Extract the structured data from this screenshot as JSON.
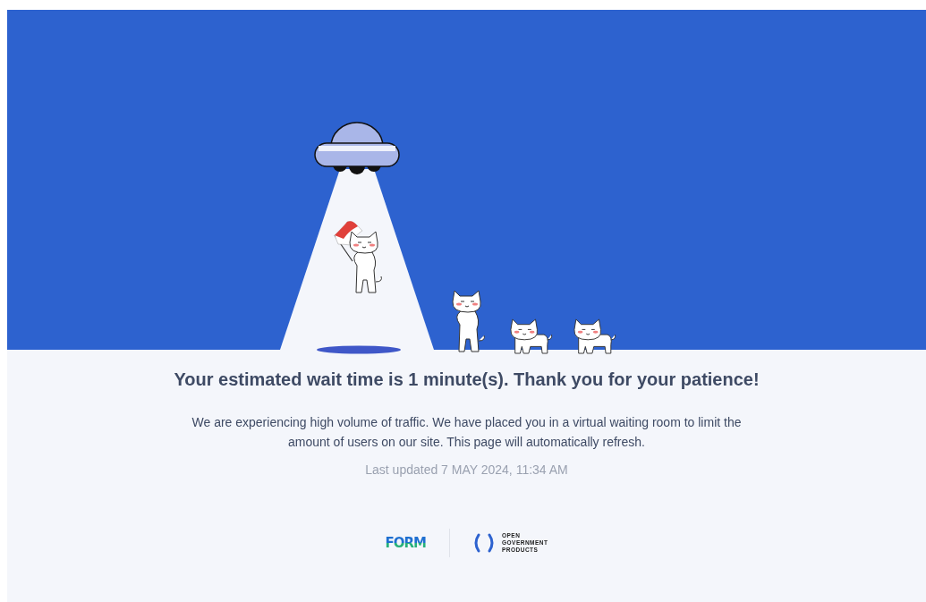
{
  "heading": "Your estimated wait time is 1 minute(s). Thank you for your patience!",
  "message": "We are experiencing high volume of traffic. We have placed you in a virtual waiting room to limit the amount of users on our site. This page will automatically refresh.",
  "last_updated": "Last updated 7 MAY 2024, 11:34 AM",
  "footer": {
    "form_logo": "FORM",
    "ogp_logo": [
      "OPEN",
      "GOVERNMENT",
      "PRODUCTS"
    ]
  }
}
